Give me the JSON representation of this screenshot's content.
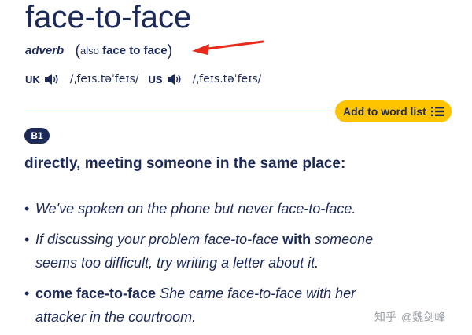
{
  "entry": {
    "headword": "face-to-face",
    "pos": "adverb",
    "also_label": "also",
    "also_form": "face to face",
    "open_paren": "(",
    "close_paren": ")"
  },
  "pronunciation": {
    "uk_label": "UK",
    "uk_ipa": "/ˌfeɪs.təˈfeɪs/",
    "us_label": "US",
    "us_ipa": "/ˌfeɪs.təˈfeɪs/"
  },
  "actions": {
    "add_to_word_list": "Add to word list"
  },
  "sense": {
    "level": "B1",
    "definition": "directly, meeting someone in the same place:",
    "examples": [
      {
        "text": "We've spoken on the phone but never face-to-face."
      },
      {
        "before": "If discussing your problem face-to-face ",
        "bold": "with",
        "after": " someone",
        "line2": "seems too difficult, try writing a letter about it."
      },
      {
        "collocation": "come face-to-face",
        "text": " She came face-to-face with her",
        "line2": "attacker in the courtroom."
      }
    ]
  },
  "watermark": {
    "site": "知乎",
    "author": "@魏剑峰"
  },
  "colors": {
    "navy": "#1d2a57",
    "yellow": "#fec400",
    "arrow_red": "#e8291c"
  }
}
